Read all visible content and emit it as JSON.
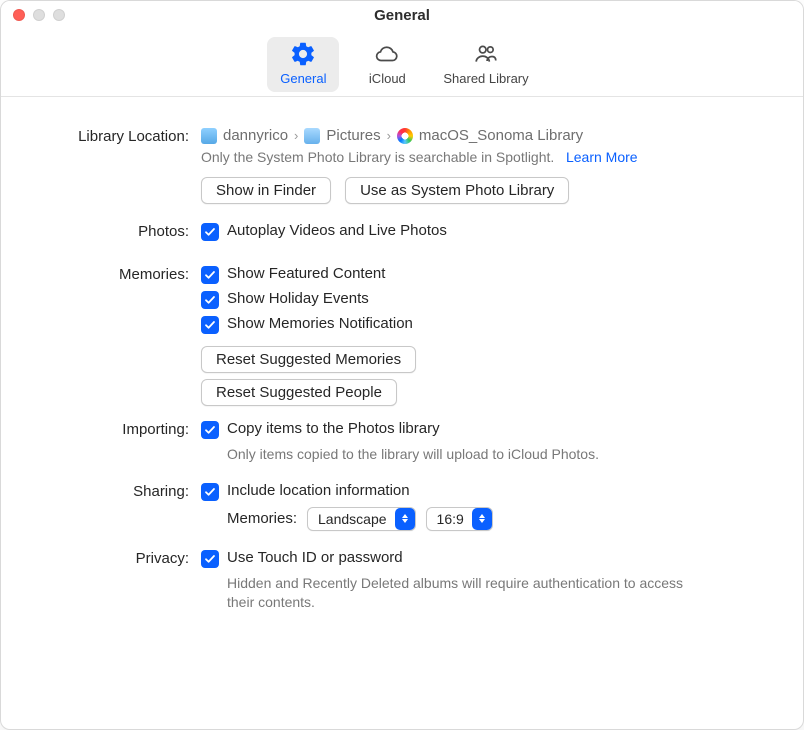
{
  "window": {
    "title": "General"
  },
  "tabs": {
    "general": "General",
    "icloud": "iCloud",
    "shared": "Shared Library"
  },
  "library": {
    "label": "Library Location:",
    "path": {
      "seg1": "dannyrico",
      "seg2": "Pictures",
      "seg3": "macOS_Sonoma Library"
    },
    "hint": "Only the System Photo Library is searchable in Spotlight.",
    "learn_more": "Learn More",
    "show_in_finder": "Show in Finder",
    "use_as_system": "Use as System Photo Library"
  },
  "photos": {
    "label": "Photos:",
    "autoplay": "Autoplay Videos and Live Photos"
  },
  "memories": {
    "label": "Memories:",
    "featured": "Show Featured Content",
    "holiday": "Show Holiday Events",
    "notification": "Show Memories Notification",
    "reset_memories": "Reset Suggested Memories",
    "reset_people": "Reset Suggested People"
  },
  "importing": {
    "label": "Importing:",
    "copy": "Copy items to the Photos library",
    "hint": "Only items copied to the library will upload to iCloud Photos."
  },
  "sharing": {
    "label": "Sharing:",
    "include_location": "Include location information",
    "memories_label": "Memories:",
    "orientation": "Landscape",
    "aspect": "16:9"
  },
  "privacy": {
    "label": "Privacy:",
    "touchid": "Use Touch ID or password",
    "hint": "Hidden and Recently Deleted albums will require authentication to access their contents."
  }
}
